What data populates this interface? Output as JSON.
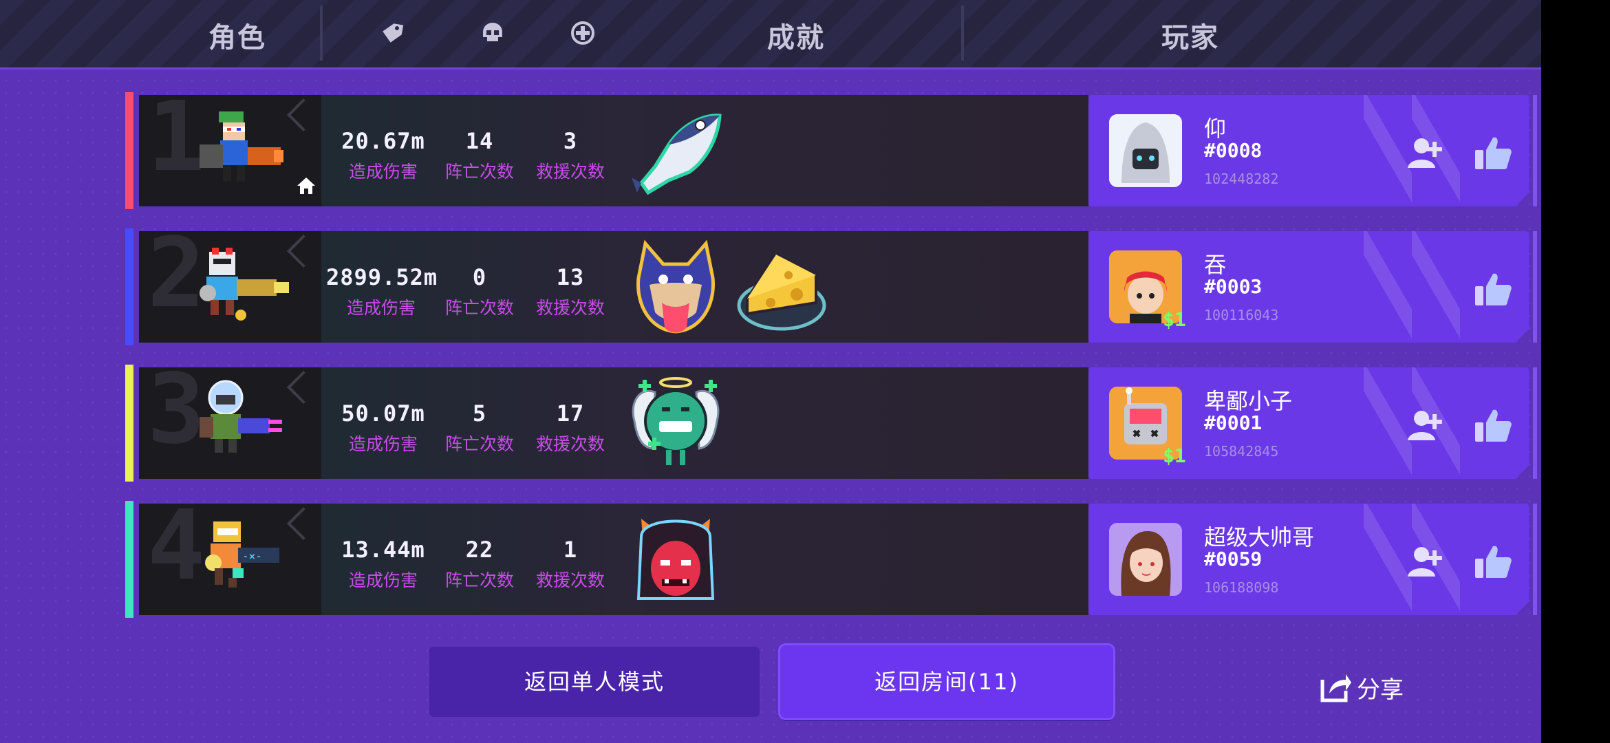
{
  "header": {
    "col_character": "角色",
    "col_achievement": "成就",
    "col_player": "玩家",
    "icons": [
      "tag-icon",
      "skull-icon",
      "revive-plus-icon"
    ]
  },
  "stat_labels": {
    "damage": "造成伤害",
    "deaths": "阵亡次数",
    "rescues": "救援次数"
  },
  "rows": [
    {
      "rank": "1",
      "accent": "#ff4d6d",
      "damage": "20.67m",
      "deaths": "14",
      "rescues": "3",
      "achievements": [
        "fish-sticker"
      ],
      "player": {
        "name": "仰",
        "tag": "#0008",
        "id": "102448282",
        "show_add": true
      },
      "is_self": true
    },
    {
      "rank": "2",
      "accent": "#4a4aff",
      "damage": "2899.52m",
      "deaths": "0",
      "rescues": "13",
      "achievements": [
        "wolf-sticker",
        "cheese-sticker"
      ],
      "player": {
        "name": "吞",
        "tag": "#0003",
        "id": "100116043",
        "show_add": false,
        "badge": "$1"
      },
      "is_self": false
    },
    {
      "rank": "3",
      "accent": "#e8f05a",
      "damage": "50.07m",
      "deaths": "5",
      "rescues": "17",
      "achievements": [
        "green-angel-sticker"
      ],
      "player": {
        "name": "卑鄙小子",
        "tag": "#0001",
        "id": "105842845",
        "show_add": true,
        "badge": "$1"
      },
      "is_self": false
    },
    {
      "rank": "4",
      "accent": "#3ee6c0",
      "damage": "13.44m",
      "deaths": "22",
      "rescues": "1",
      "achievements": [
        "red-demon-sticker"
      ],
      "player": {
        "name": "超级大帅哥",
        "tag": "#0059",
        "id": "106188098",
        "show_add": true
      },
      "is_self": false
    }
  ],
  "buttons": {
    "back_single": "返回单人模式",
    "back_room": "返回房间(11)",
    "share": "分享"
  }
}
